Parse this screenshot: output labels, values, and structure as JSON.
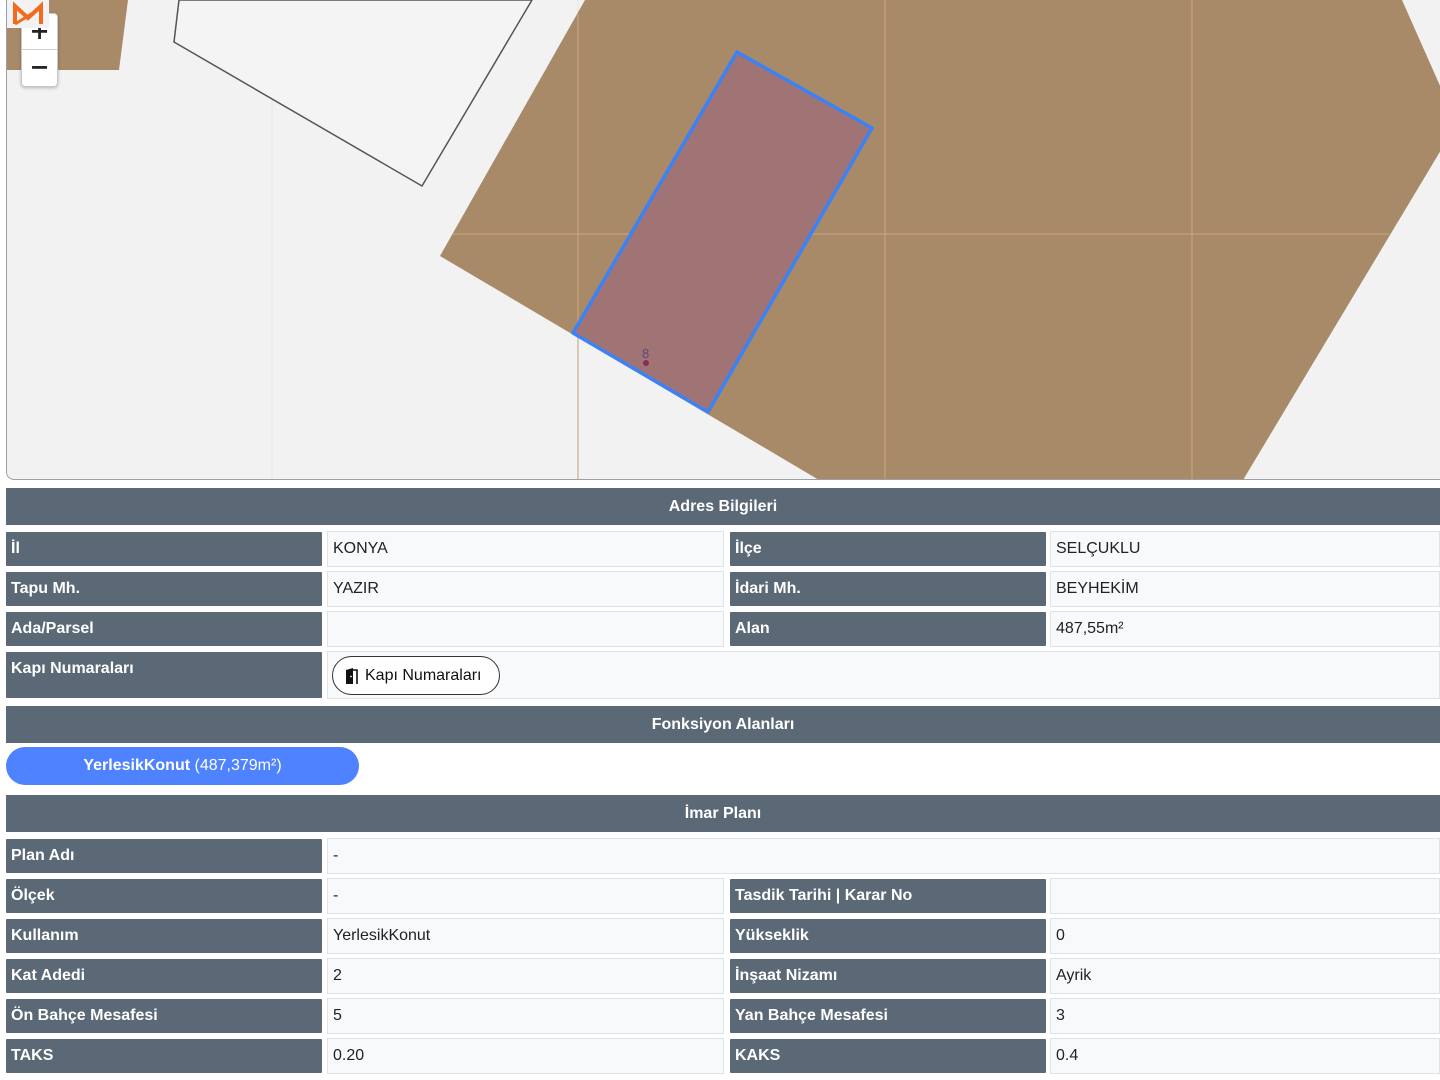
{
  "map": {
    "zoom_in": "+",
    "zoom_out": "−",
    "parcel_label": "8",
    "logo_icon": "logo-icon"
  },
  "address": {
    "title": "Adres Bilgileri",
    "il_label": "İl",
    "il_value": "KONYA",
    "ilce_label": "İlçe",
    "ilce_value": "SELÇUKLU",
    "tapu_label": "Tapu Mh.",
    "tapu_value": "YAZIR",
    "idari_label": "İdari Mh.",
    "idari_value": "BEYHEKİM",
    "ada_label": "Ada/Parsel",
    "ada_value": "",
    "alan_label": "Alan",
    "alan_value": "487,55m²",
    "kapi_label": "Kapı Numaraları",
    "kapi_button": "Kapı Numaraları",
    "kapi_icon": "door-icon"
  },
  "functions": {
    "title": "Fonksiyon Alanları",
    "items": [
      {
        "name": "YerlesikKonut",
        "area": "(487,379m²)"
      }
    ]
  },
  "imar": {
    "title": "İmar Planı",
    "plan_adi_label": "Plan Adı",
    "plan_adi_value": "-",
    "olcek_label": "Ölçek",
    "olcek_value": "-",
    "tasdik_label": "Tasdik Tarihi | Karar No",
    "tasdik_value": "",
    "kullanim_label": "Kullanım",
    "kullanim_value": "YerlesikKonut",
    "yukseklik_label": "Yükseklik",
    "yukseklik_value": "0",
    "kat_label": "Kat Adedi",
    "kat_value": "2",
    "insaat_label": "İnşaat Nizamı",
    "insaat_value": "Ayrik",
    "on_bahce_label": "Ön Bahçe Mesafesi",
    "on_bahce_value": "5",
    "yan_bahce_label": "Yan Bahçe Mesafesi",
    "yan_bahce_value": "3",
    "taks_label": "TAKS",
    "taks_value": "0.20",
    "kaks_label": "KAKS",
    "kaks_value": "0.4"
  },
  "colors": {
    "header_bg": "#5b6876",
    "parcel_fill": "#a88a68",
    "selected_fill": "#a07375",
    "selected_stroke": "#3b82f6",
    "function_pill": "#4e82ff"
  }
}
